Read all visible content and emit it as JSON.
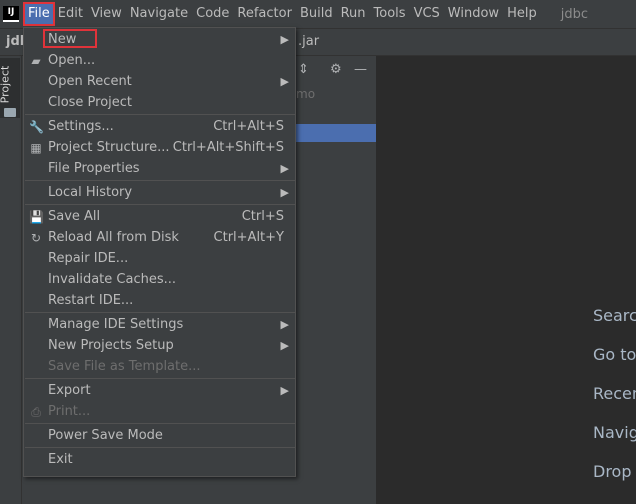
{
  "menubar": {
    "logo_text": "IJ",
    "items": [
      "File",
      "Edit",
      "View",
      "Navigate",
      "Code",
      "Refactor",
      "Build",
      "Run",
      "Tools",
      "VCS",
      "Window",
      "Help"
    ],
    "project_name": "jdbc"
  },
  "navbar": {
    "left_text": "jdb",
    "right_text": ".jar"
  },
  "toolstrip": {
    "project_tab": "Project"
  },
  "panel": {
    "hint": "mo"
  },
  "editor": {
    "hints": [
      "Search",
      "Go to",
      "Recen",
      "Navig",
      "Drop"
    ]
  },
  "file_menu": {
    "items": [
      {
        "label": "New",
        "submenu": true
      },
      {
        "label": "Open...",
        "icon": "folder-icon"
      },
      {
        "label": "Open Recent",
        "submenu": true
      },
      {
        "label": "Close Project"
      },
      {
        "label": "Settings...",
        "shortcut": "Ctrl+Alt+S",
        "icon": "wrench-icon"
      },
      {
        "label": "Project Structure...",
        "shortcut": "Ctrl+Alt+Shift+S",
        "icon": "project-structure-icon"
      },
      {
        "label": "File Properties",
        "submenu": true
      },
      {
        "label": "Local History",
        "submenu": true
      },
      {
        "label": "Save All",
        "shortcut": "Ctrl+S",
        "icon": "save-icon"
      },
      {
        "label": "Reload All from Disk",
        "shortcut": "Ctrl+Alt+Y",
        "icon": "reload-icon"
      },
      {
        "label": "Repair IDE..."
      },
      {
        "label": "Invalidate Caches..."
      },
      {
        "label": "Restart IDE..."
      },
      {
        "label": "Manage IDE Settings",
        "submenu": true
      },
      {
        "label": "New Projects Setup",
        "submenu": true
      },
      {
        "label": "Save File as Template...",
        "disabled": true
      },
      {
        "label": "Export",
        "submenu": true
      },
      {
        "label": "Print...",
        "disabled": true,
        "icon": "print-icon"
      },
      {
        "label": "Power Save Mode"
      },
      {
        "label": "Exit"
      }
    ]
  }
}
